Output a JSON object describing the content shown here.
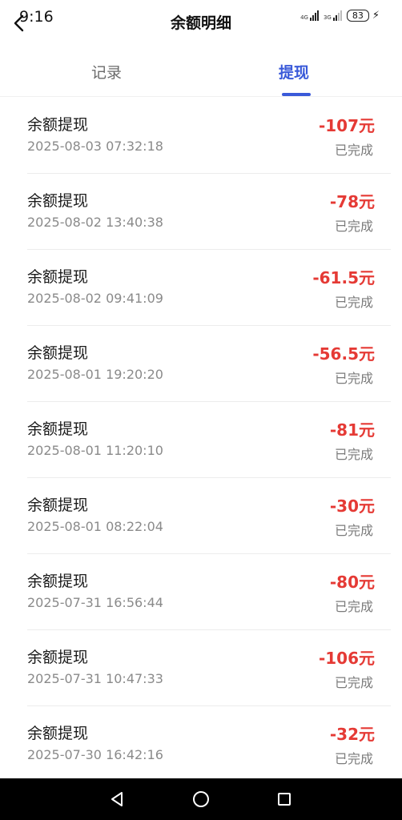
{
  "status_bar": {
    "time": "9:16",
    "network_1": "4G",
    "network_2": "3G",
    "battery": "83"
  },
  "header": {
    "title": "余额明细"
  },
  "tabs": [
    {
      "label": "记录",
      "active": false
    },
    {
      "label": "提现",
      "active": true
    }
  ],
  "records": [
    {
      "title": "余额提现",
      "time": "2025-08-03 07:32:18",
      "amount": "-107元",
      "status": "已完成"
    },
    {
      "title": "余额提现",
      "time": "2025-08-02 13:40:38",
      "amount": "-78元",
      "status": "已完成"
    },
    {
      "title": "余额提现",
      "time": "2025-08-02 09:41:09",
      "amount": "-61.5元",
      "status": "已完成"
    },
    {
      "title": "余额提现",
      "time": "2025-08-01 19:20:20",
      "amount": "-56.5元",
      "status": "已完成"
    },
    {
      "title": "余额提现",
      "time": "2025-08-01 11:20:10",
      "amount": "-81元",
      "status": "已完成"
    },
    {
      "title": "余额提现",
      "time": "2025-08-01 08:22:04",
      "amount": "-30元",
      "status": "已完成"
    },
    {
      "title": "余额提现",
      "time": "2025-07-31 16:56:44",
      "amount": "-80元",
      "status": "已完成"
    },
    {
      "title": "余额提现",
      "time": "2025-07-31 10:47:33",
      "amount": "-106元",
      "status": "已完成"
    },
    {
      "title": "余额提现",
      "time": "2025-07-30 16:42:16",
      "amount": "-32元",
      "status": "已完成"
    }
  ],
  "colors": {
    "accent": "#3a5ad9",
    "amount": "#e53a35"
  },
  "icons": {
    "back": "chevron-left-icon",
    "nav_back": "triangle-back-icon",
    "nav_home": "circle-home-icon",
    "nav_recents": "square-recents-icon"
  }
}
